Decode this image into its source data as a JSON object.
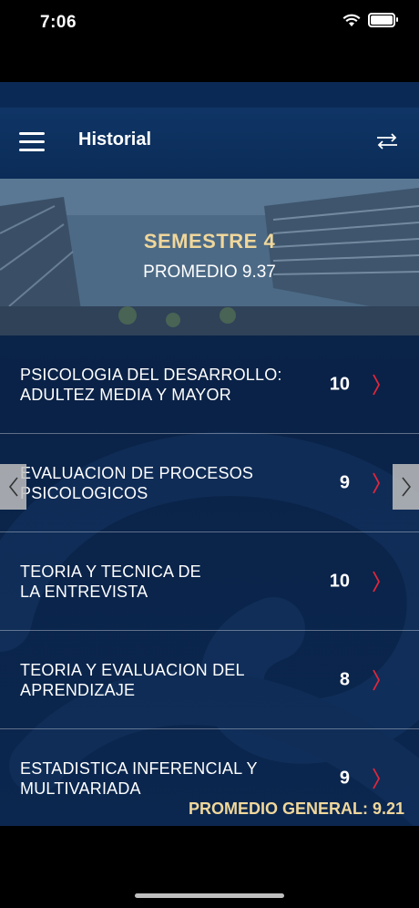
{
  "status_bar": {
    "time": "7:06"
  },
  "navbar": {
    "title": "Historial"
  },
  "hero": {
    "title": "SEMESTRE 4",
    "subtitle": "PROMEDIO 9.37"
  },
  "courses": [
    {
      "name": "PSICOLOGIA DEL DESARROLLO:\nADULTEZ MEDIA Y MAYOR",
      "grade": "10"
    },
    {
      "name": "EVALUACION DE PROCESOS\nPSICOLOGICOS",
      "grade": "9"
    },
    {
      "name": "TEORIA Y TECNICA DE\nLA ENTREVISTA",
      "grade": "10"
    },
    {
      "name": "TEORIA Y EVALUACION DEL\nAPRENDIZAJE",
      "grade": "8"
    },
    {
      "name": "ESTADISTICA INFERENCIAL Y\nMULTIVARIADA",
      "grade": "9"
    }
  ],
  "footer": {
    "general_average": "PROMEDIO GENERAL: 9.21"
  },
  "colors": {
    "accent_gold": "#f0d79b",
    "chevron_red": "#e0263b",
    "background_navy": "#0b274f"
  }
}
